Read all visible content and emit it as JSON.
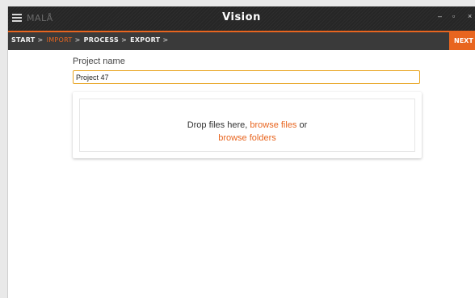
{
  "app": {
    "logo_text": "MALÅ",
    "title": "Vision"
  },
  "window_controls": {
    "minimize": "–",
    "maximize": "▫",
    "close": "×"
  },
  "breadcrumb": {
    "items": [
      {
        "label": "START",
        "active": false
      },
      {
        "label": "IMPORT",
        "active": true
      },
      {
        "label": "PROCESS",
        "active": false
      },
      {
        "label": "EXPORT",
        "active": false
      }
    ],
    "separator": ">",
    "next_label": "NEXT",
    "next_icon": "»"
  },
  "form": {
    "project_name_label": "Project name",
    "project_name_value": "Project 47"
  },
  "dropzone": {
    "text_before": "Drop files here,",
    "browse_files": "browse files",
    "text_or": "or",
    "browse_folders": "browse folders"
  },
  "colors": {
    "accent": "#e8651f",
    "titlebar": "#262626",
    "breadcrumb_bar": "#3a3a3a"
  }
}
